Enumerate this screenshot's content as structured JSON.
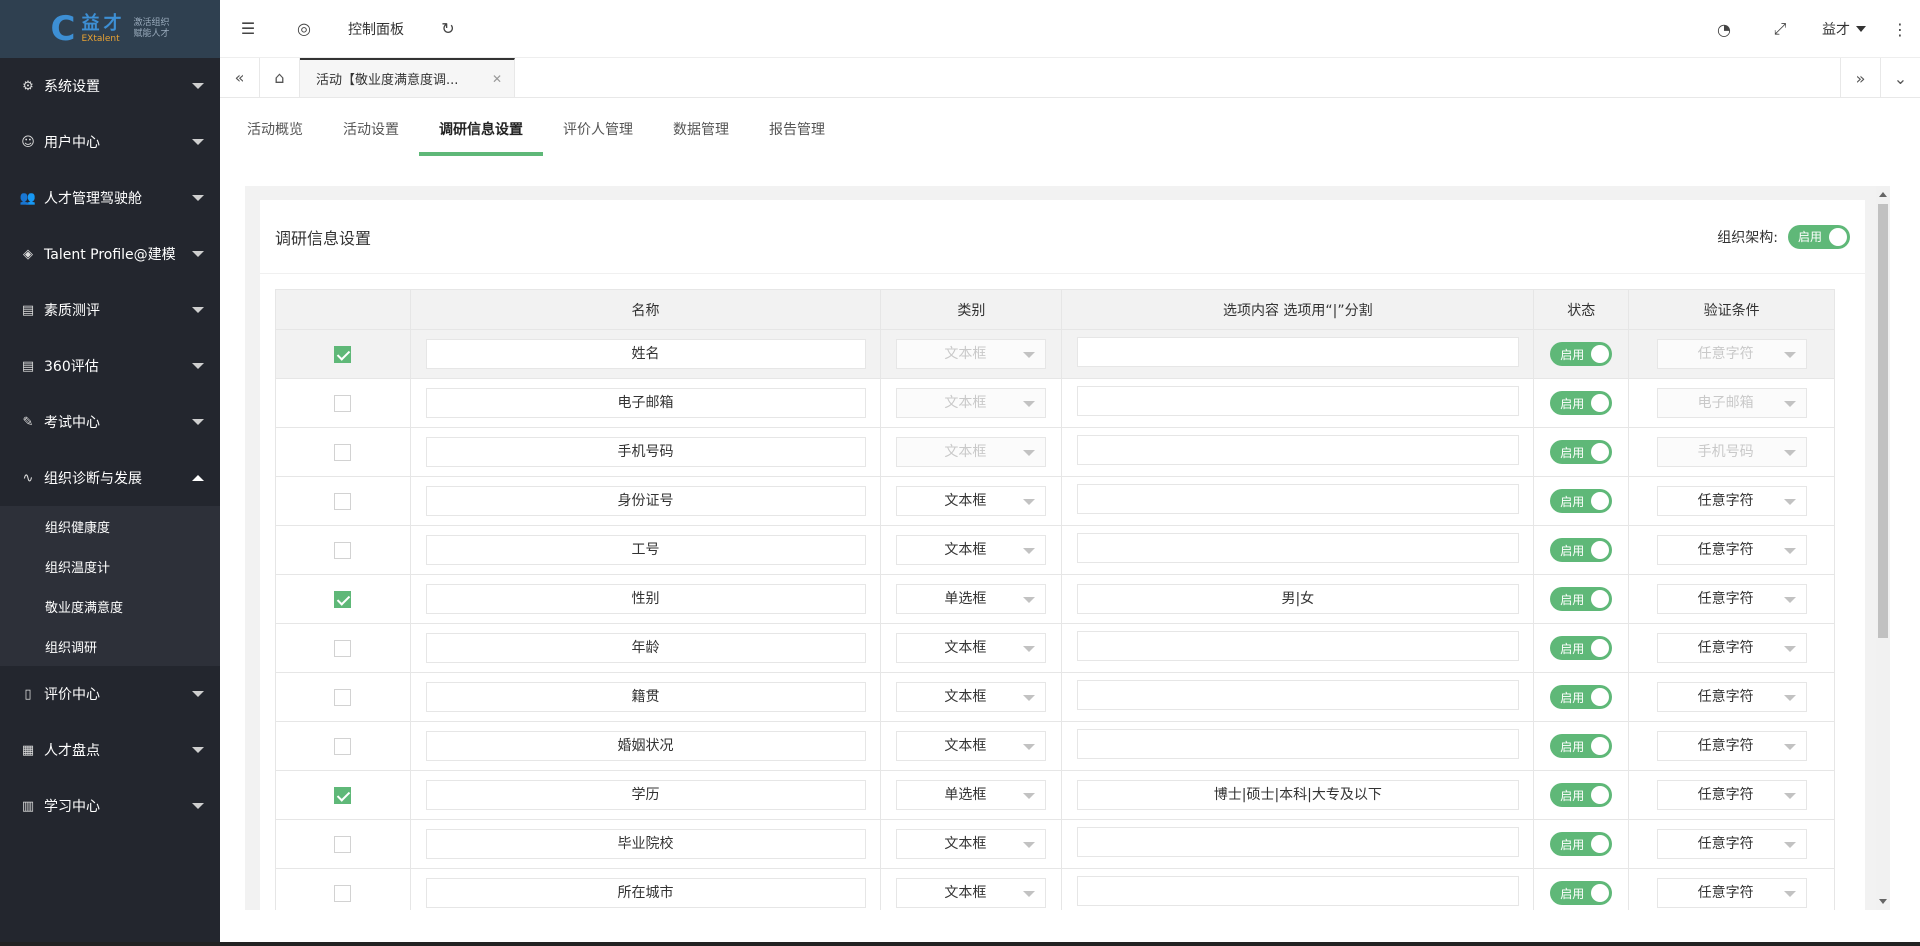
{
  "brand": {
    "logo_mark": "C",
    "name_cn": "益才",
    "name_en": "EXtalent",
    "slogan_1": "激活组织",
    "slogan_2": "赋能人才"
  },
  "sidebar": {
    "items": [
      {
        "label": "系统设置",
        "icon": "gear-icon"
      },
      {
        "label": "用户中心",
        "icon": "user-icon"
      },
      {
        "label": "人才管理驾驶舱",
        "icon": "users-icon"
      },
      {
        "label": "Talent Profile@建模",
        "icon": "layers-icon"
      },
      {
        "label": "素质测评",
        "icon": "clipboard-icon"
      },
      {
        "label": "360评估",
        "icon": "clipboard-icon"
      },
      {
        "label": "考试中心",
        "icon": "pen-icon"
      },
      {
        "label": "组织诊断与发展",
        "icon": "pulse-icon"
      }
    ],
    "submenu": [
      "组织健康度",
      "组织温度计",
      "敬业度满意度",
      "组织调研"
    ],
    "items_after": [
      {
        "label": "评价中心",
        "icon": "tablet-icon"
      },
      {
        "label": "人才盘点",
        "icon": "grid-icon"
      },
      {
        "label": "学习中心",
        "icon": "book-icon"
      }
    ]
  },
  "topbar": {
    "dashboard_label": "控制面板",
    "user_name": "益才"
  },
  "tabbar": {
    "page_tab": "活动【敬业度满意度调..."
  },
  "subtabs": [
    "活动概览",
    "活动设置",
    "调研信息设置",
    "评价人管理",
    "数据管理",
    "报告管理"
  ],
  "card": {
    "title": "调研信息设置",
    "org_label": "组织架构:",
    "org_switch": "启用"
  },
  "table": {
    "headers": [
      "名称",
      "类别",
      "选项内容 选项用“|”分割",
      "状态",
      "验证条件"
    ],
    "rows": [
      {
        "checked": true,
        "name": "姓名",
        "type": "文本框",
        "type_disabled": true,
        "options": "",
        "status": "启用",
        "rule": "任意字符",
        "rule_disabled": true
      },
      {
        "checked": false,
        "name": "电子邮箱",
        "type": "文本框",
        "type_disabled": true,
        "options": "",
        "status": "启用",
        "rule": "电子邮箱",
        "rule_disabled": true
      },
      {
        "checked": false,
        "name": "手机号码",
        "type": "文本框",
        "type_disabled": true,
        "options": "",
        "status": "启用",
        "rule": "手机号码",
        "rule_disabled": true
      },
      {
        "checked": false,
        "name": "身份证号",
        "type": "文本框",
        "type_disabled": false,
        "options": "",
        "status": "启用",
        "rule": "任意字符",
        "rule_disabled": false
      },
      {
        "checked": false,
        "name": "工号",
        "type": "文本框",
        "type_disabled": false,
        "options": "",
        "status": "启用",
        "rule": "任意字符",
        "rule_disabled": false
      },
      {
        "checked": true,
        "name": "性别",
        "type": "单选框",
        "type_disabled": false,
        "options": "男|女",
        "status": "启用",
        "rule": "任意字符",
        "rule_disabled": false
      },
      {
        "checked": false,
        "name": "年龄",
        "type": "文本框",
        "type_disabled": false,
        "options": "",
        "status": "启用",
        "rule": "任意字符",
        "rule_disabled": false
      },
      {
        "checked": false,
        "name": "籍贯",
        "type": "文本框",
        "type_disabled": false,
        "options": "",
        "status": "启用",
        "rule": "任意字符",
        "rule_disabled": false
      },
      {
        "checked": false,
        "name": "婚姻状况",
        "type": "文本框",
        "type_disabled": false,
        "options": "",
        "status": "启用",
        "rule": "任意字符",
        "rule_disabled": false
      },
      {
        "checked": true,
        "name": "学历",
        "type": "单选框",
        "type_disabled": false,
        "options": "博士|硕士|本科|大专及以下",
        "status": "启用",
        "rule": "任意字符",
        "rule_disabled": false
      },
      {
        "checked": false,
        "name": "毕业院校",
        "type": "文本框",
        "type_disabled": false,
        "options": "",
        "status": "启用",
        "rule": "任意字符",
        "rule_disabled": false
      },
      {
        "checked": false,
        "name": "所在城市",
        "type": "文本框",
        "type_disabled": false,
        "options": "",
        "status": "启用",
        "rule": "任意字符",
        "rule_disabled": false
      }
    ]
  },
  "colors": {
    "sidebar_bg": "#23262e",
    "accent_green": "#5fb878",
    "logo_blue": "#3d8fd4"
  }
}
